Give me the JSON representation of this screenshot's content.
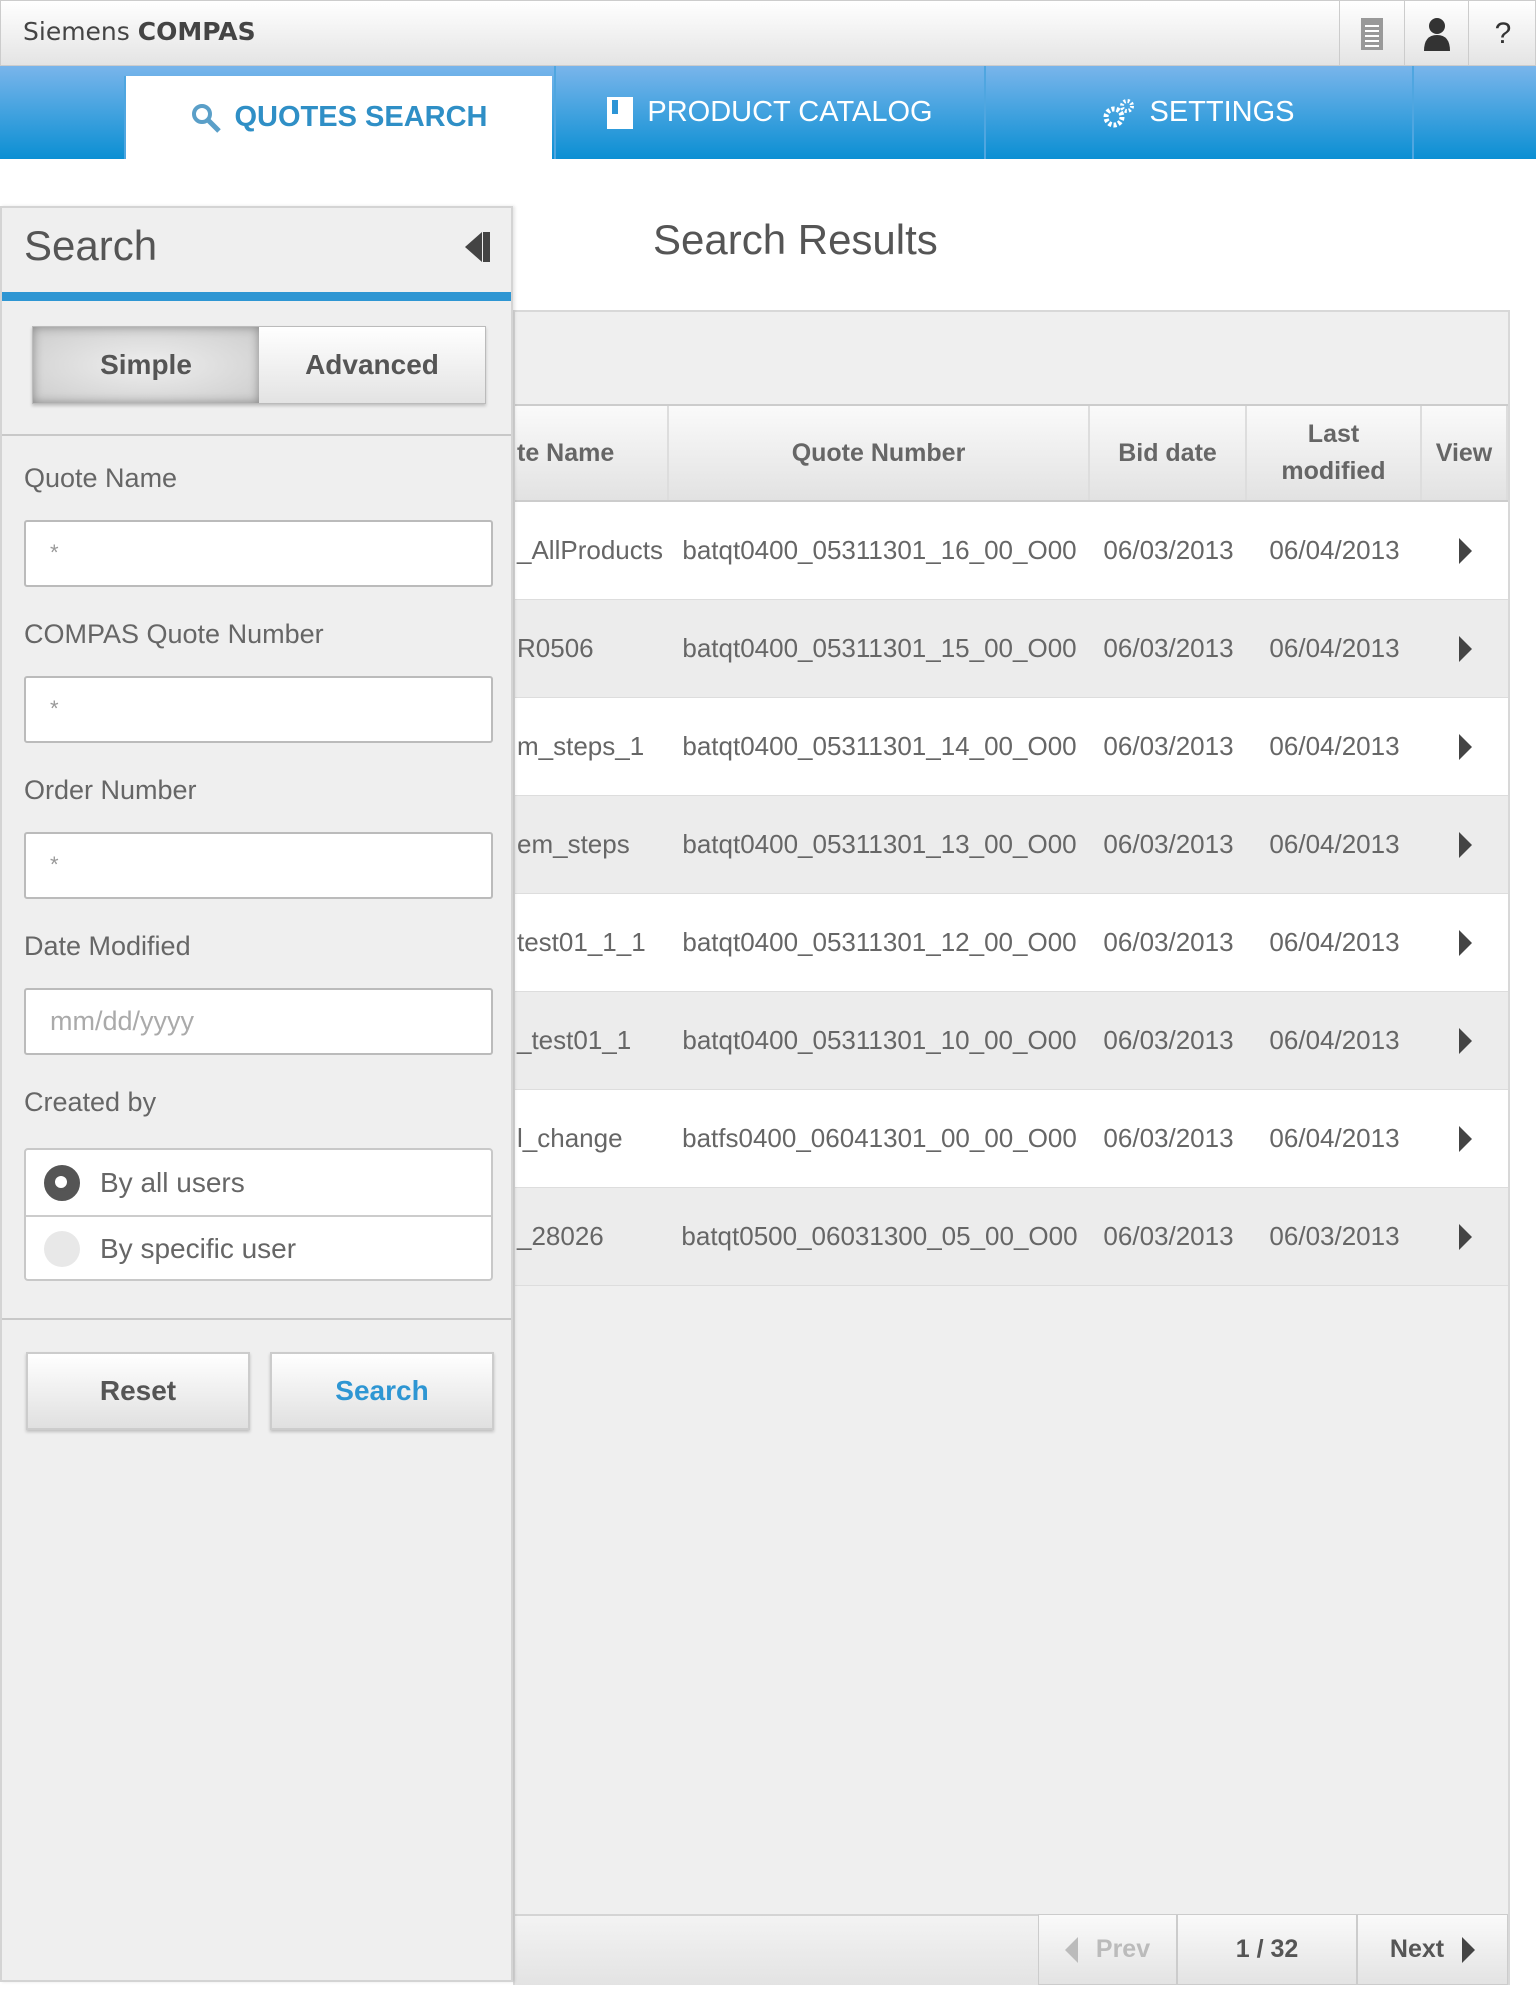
{
  "app": {
    "title_light": "Siemens",
    "title_bold": "COMPAS",
    "icons": [
      "document-list-icon",
      "user-icon",
      "help-icon"
    ]
  },
  "tabs": [
    {
      "label": "QUOTES SEARCH",
      "icon": "search-icon",
      "active": true
    },
    {
      "label": "PRODUCT CATALOG",
      "icon": "book-icon"
    },
    {
      "label": "SETTINGS",
      "icon": "gears-icon"
    }
  ],
  "search_panel": {
    "title": "Search",
    "toggle": {
      "simple": "Simple",
      "advanced": "Advanced",
      "selected": "Simple"
    },
    "fields": [
      {
        "label": "Quote Name",
        "value": "*"
      },
      {
        "label": "COMPAS Quote Number",
        "value": "*"
      },
      {
        "label": "Order Number",
        "value": "*"
      },
      {
        "label": "Date Modified",
        "placeholder": "mm/dd/yyyy"
      }
    ],
    "created_by": {
      "label": "Created by",
      "options": [
        "By all users",
        "By specific user"
      ],
      "selected": "By all users"
    },
    "reset": "Reset",
    "search": "Search"
  },
  "results": {
    "title": "Search Results",
    "columns": [
      "te Name",
      "Quote Number",
      "Bid date",
      "Last modified",
      "View"
    ],
    "rows": [
      [
        "_AllProducts",
        "batqt0400_05311301_16_00_O00",
        "06/03/2013",
        "06/04/2013"
      ],
      [
        "R0506",
        "batqt0400_05311301_15_00_O00",
        "06/03/2013",
        "06/04/2013"
      ],
      [
        "m_steps_1",
        "batqt0400_05311301_14_00_O00",
        "06/03/2013",
        "06/04/2013"
      ],
      [
        "em_steps",
        "batqt0400_05311301_13_00_O00",
        "06/03/2013",
        "06/04/2013"
      ],
      [
        "test01_1_1",
        "batqt0400_05311301_12_00_O00",
        "06/03/2013",
        "06/04/2013"
      ],
      [
        "_test01_1",
        "batqt0400_05311301_10_00_O00",
        "06/03/2013",
        "06/04/2013"
      ],
      [
        "l_change",
        "batfs0400_06041301_00_00_O00",
        "06/03/2013",
        "06/04/2013"
      ],
      [
        "_28026",
        "batqt0500_06031300_05_00_O00",
        "06/03/2013",
        "06/03/2013"
      ]
    ],
    "pager": {
      "prev": "Prev",
      "page": "1 / 32",
      "next": "Next"
    }
  },
  "colors": {
    "accent": "#2e96d3",
    "tab_gradient_top": "#79b5eb",
    "tab_gradient_bottom": "#0b8fd3"
  }
}
